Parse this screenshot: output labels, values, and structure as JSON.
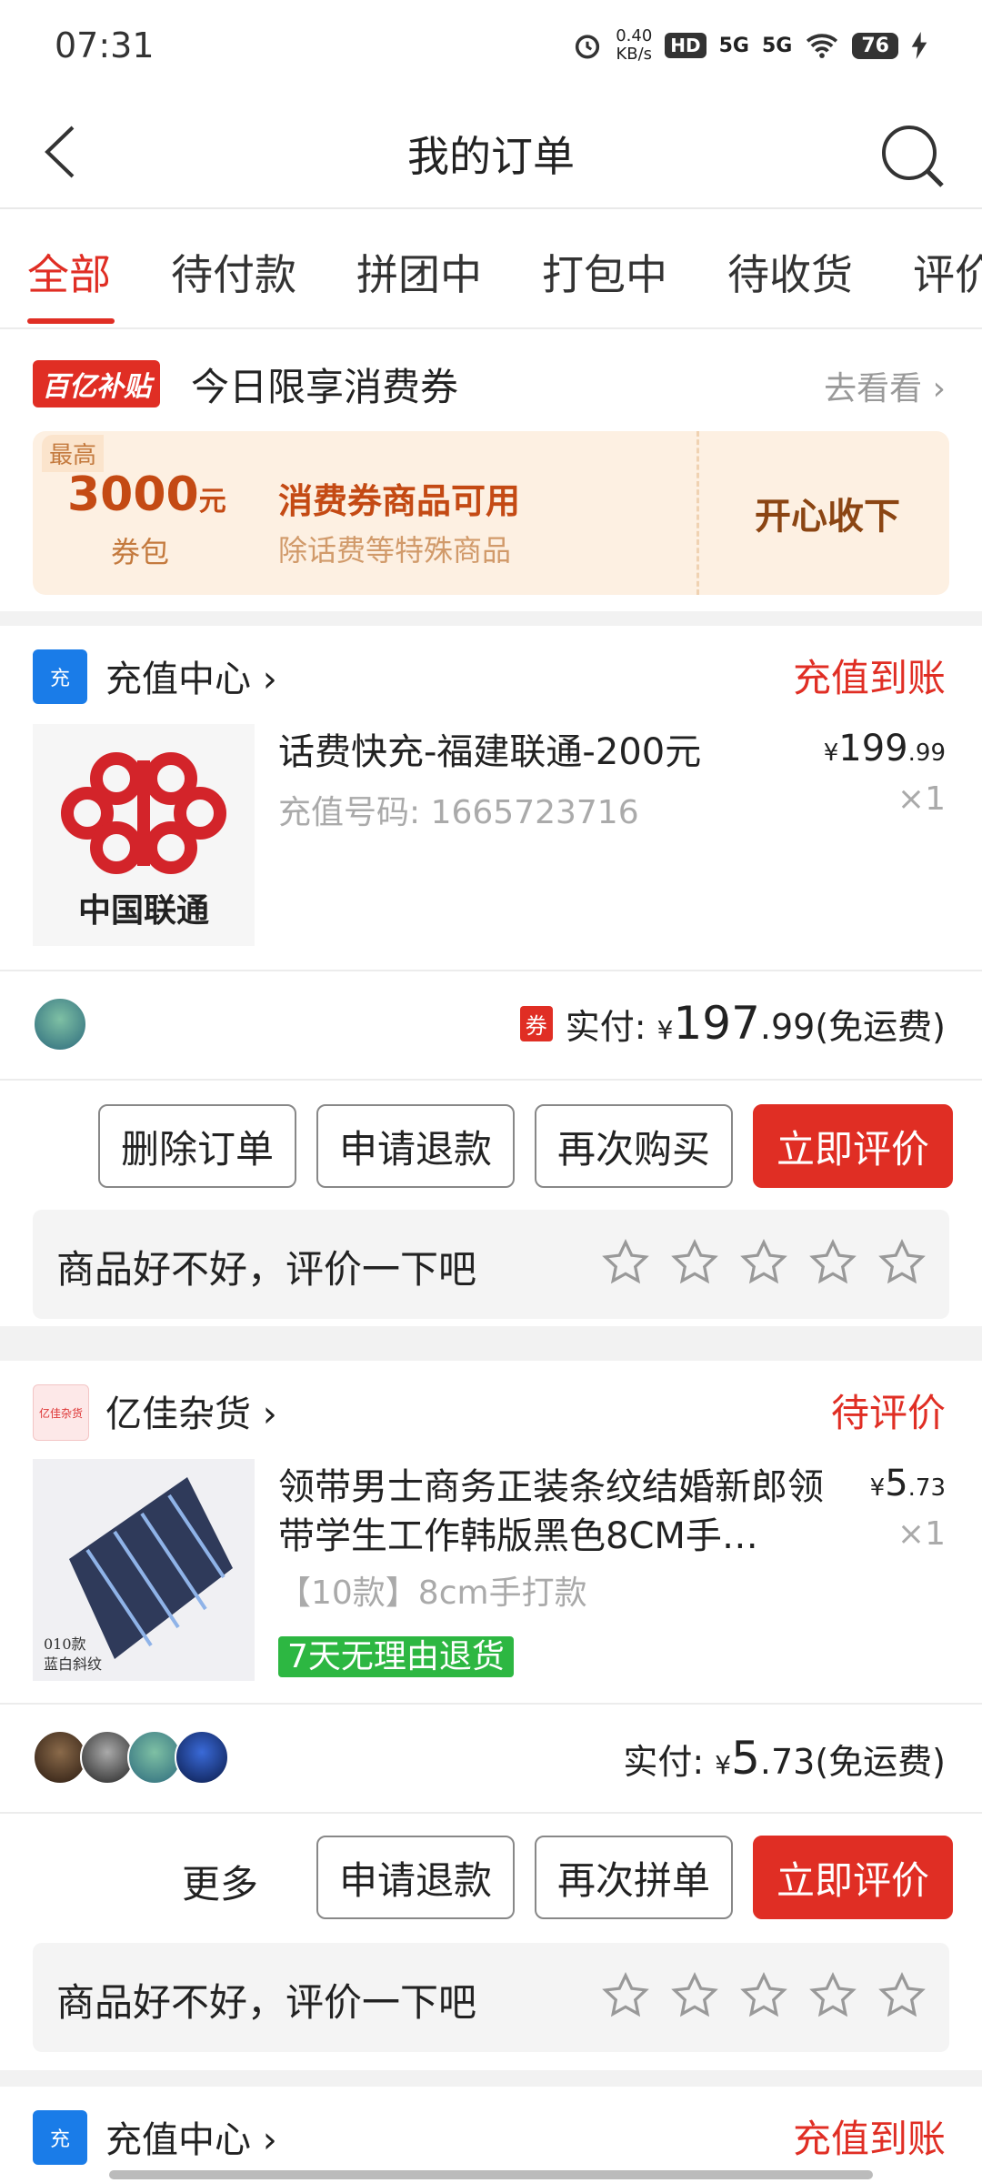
{
  "status_bar": {
    "time": "07:31",
    "net_speed_value": "0.40",
    "net_speed_unit": "KB/s",
    "hd_label": "HD",
    "signal1": "5G",
    "signal2": "5G",
    "battery": "76"
  },
  "header": {
    "title": "我的订单"
  },
  "tabs": [
    "全部",
    "待付款",
    "拼团中",
    "打包中",
    "待收货",
    "评价"
  ],
  "coupon_banner": {
    "badge": "百亿补贴",
    "title": "今日限享消费券",
    "more": "去看看 ›",
    "cap": "最高",
    "amount": "3000",
    "amount_unit": "元",
    "pack": "券包",
    "main": "消费券商品可用",
    "sub": "除话费等特殊商品",
    "claim": "开心收下"
  },
  "orders": [
    {
      "shop": "充值中心 ›",
      "shop_icon": "充",
      "status": "充值到账",
      "thumb_text": "中国联通",
      "title": "话费快充-福建联通-200元",
      "subtitle": "充值号码: 1665723716",
      "price_symbol": "¥",
      "price_int": "199",
      "price_dec": ".99",
      "qty": "×1",
      "coupon_tag": "券",
      "paid_label": "实付:",
      "paid_symbol": "¥",
      "paid_int": "197",
      "paid_dec": ".99",
      "paid_note": "(免运费)",
      "buttons": [
        "删除订单",
        "申请退款",
        "再次购买",
        "立即评价"
      ],
      "rate_prompt": "商品好不好，评价一下吧"
    },
    {
      "shop": "亿佳杂货 ›",
      "shop_icon": "亿佳杂货",
      "status": "待评价",
      "thumb_caption_1": "010款",
      "thumb_caption_2": "蓝白斜纹",
      "title": "领带男士商务正装条纹结婚新郎领带学生工作韩版黑色8CM手…",
      "subtitle": "【10款】8cm手打款",
      "tag": "7天无理由退货",
      "price_symbol": "¥",
      "price_int": "5",
      "price_dec": ".73",
      "qty": "×1",
      "paid_label": "实付:",
      "paid_symbol": "¥",
      "paid_int": "5",
      "paid_dec": ".73",
      "paid_note": "(免运费)",
      "more": "更多",
      "buttons": [
        "申请退款",
        "再次拼单",
        "立即评价"
      ],
      "rate_prompt": "商品好不好，评价一下吧"
    },
    {
      "shop": "充值中心 ›",
      "shop_icon": "充",
      "status": "充值到账"
    }
  ],
  "colors": {
    "accent": "#e02e24",
    "green": "#2db742",
    "coupon_bg": "#fdf0e2"
  },
  "icons": [
    "back-icon",
    "search-icon",
    "star-icon",
    "alarm-icon",
    "wifi-icon",
    "charging-icon"
  ]
}
